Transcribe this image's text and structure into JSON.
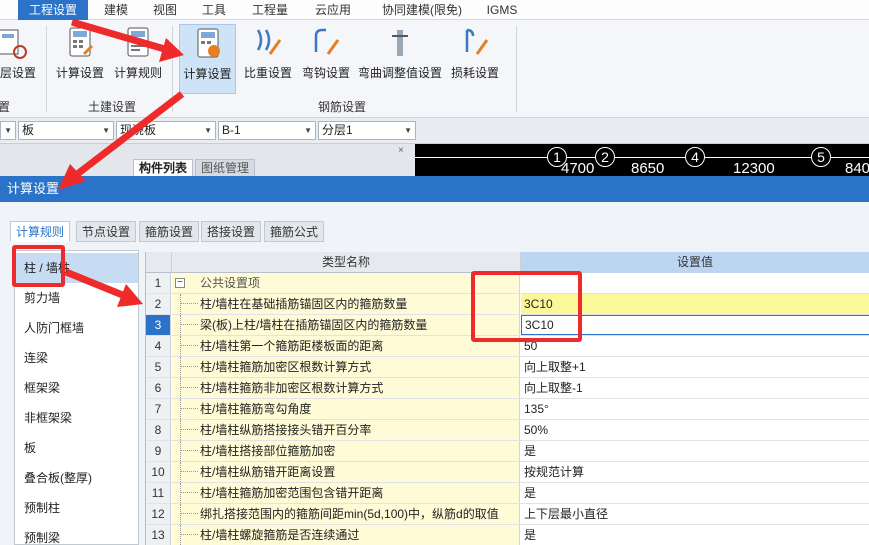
{
  "menu": {
    "items": [
      "工程设置",
      "建模",
      "视图",
      "工具",
      "工程量",
      "云应用",
      "协同建模(限免)",
      "IGMS"
    ],
    "active_index": 0
  },
  "ribbon": {
    "buttons": [
      {
        "label": "层设置"
      },
      {
        "label": "计算设置"
      },
      {
        "label": "计算规则"
      },
      {
        "label": "计算设置"
      },
      {
        "label": "比重设置"
      },
      {
        "label": "弯钩设置"
      },
      {
        "label": "弯曲调整值设置"
      },
      {
        "label": "损耗设置"
      }
    ],
    "groups": {
      "left_stub": "置",
      "civil": "土建设置",
      "rebar": "钢筋设置"
    }
  },
  "toolbar": {
    "combos": [
      "",
      "板",
      "现浇板",
      "B-1",
      "分层1"
    ]
  },
  "panel": {
    "tab_components": "构件列表",
    "tab_drawings": "图纸管理",
    "close_glyph": "×"
  },
  "canvas": {
    "axes": [
      "1",
      "2",
      "4",
      "5"
    ],
    "dims": [
      "4700",
      "8650",
      "12300",
      "840"
    ]
  },
  "dialog": {
    "title": "计算设置",
    "tabs": [
      "计算规则",
      "节点设置",
      "箍筋设置",
      "搭接设置",
      "箍筋公式"
    ],
    "active_tab": 0,
    "left_items": [
      "柱 / 墙柱",
      "剪力墙",
      "人防门框墙",
      "连梁",
      "框架梁",
      "非框架梁",
      "板",
      "叠合板(整厚)",
      "预制柱",
      "预制梁"
    ],
    "grid": {
      "col_name": "类型名称",
      "col_value": "设置值",
      "rows": [
        {
          "num": "1",
          "name": "公共设置项",
          "value": ""
        },
        {
          "num": "2",
          "name": "柱/墙柱在基础插筋锚固区内的箍筋数量",
          "value": "3C10"
        },
        {
          "num": "3",
          "name": "梁(板)上柱/墙柱在插筋锚固区内的箍筋数量",
          "value": "3C10"
        },
        {
          "num": "4",
          "name": "柱/墙柱第一个箍筋距楼板面的距离",
          "value": "50"
        },
        {
          "num": "5",
          "name": "柱/墙柱箍筋加密区根数计算方式",
          "value": "向上取整+1"
        },
        {
          "num": "6",
          "name": "柱/墙柱箍筋非加密区根数计算方式",
          "value": "向上取整-1"
        },
        {
          "num": "7",
          "name": "柱/墙柱箍筋弯勾角度",
          "value": "135°"
        },
        {
          "num": "8",
          "name": "柱/墙柱纵筋搭接接头错开百分率",
          "value": "50%"
        },
        {
          "num": "9",
          "name": "柱/墙柱搭接部位箍筋加密",
          "value": "是"
        },
        {
          "num": "10",
          "name": "柱/墙柱纵筋错开距离设置",
          "value": "按规范计算"
        },
        {
          "num": "11",
          "name": "柱/墙柱箍筋加密范围包含错开距离",
          "value": "是"
        },
        {
          "num": "12",
          "name": "绑扎搭接范围内的箍筋间距min(5d,100)中，纵筋d的取值",
          "value": "上下层最小直径"
        },
        {
          "num": "13",
          "name": "柱/墙柱螺旋箍筋是否连续通过",
          "value": "是"
        }
      ]
    }
  },
  "colors": {
    "accent": "#2b73c8",
    "highlight_yellow": "#fbf89a",
    "name_yellow": "#fffbd6",
    "annotation_red": "#ee2a2a"
  }
}
